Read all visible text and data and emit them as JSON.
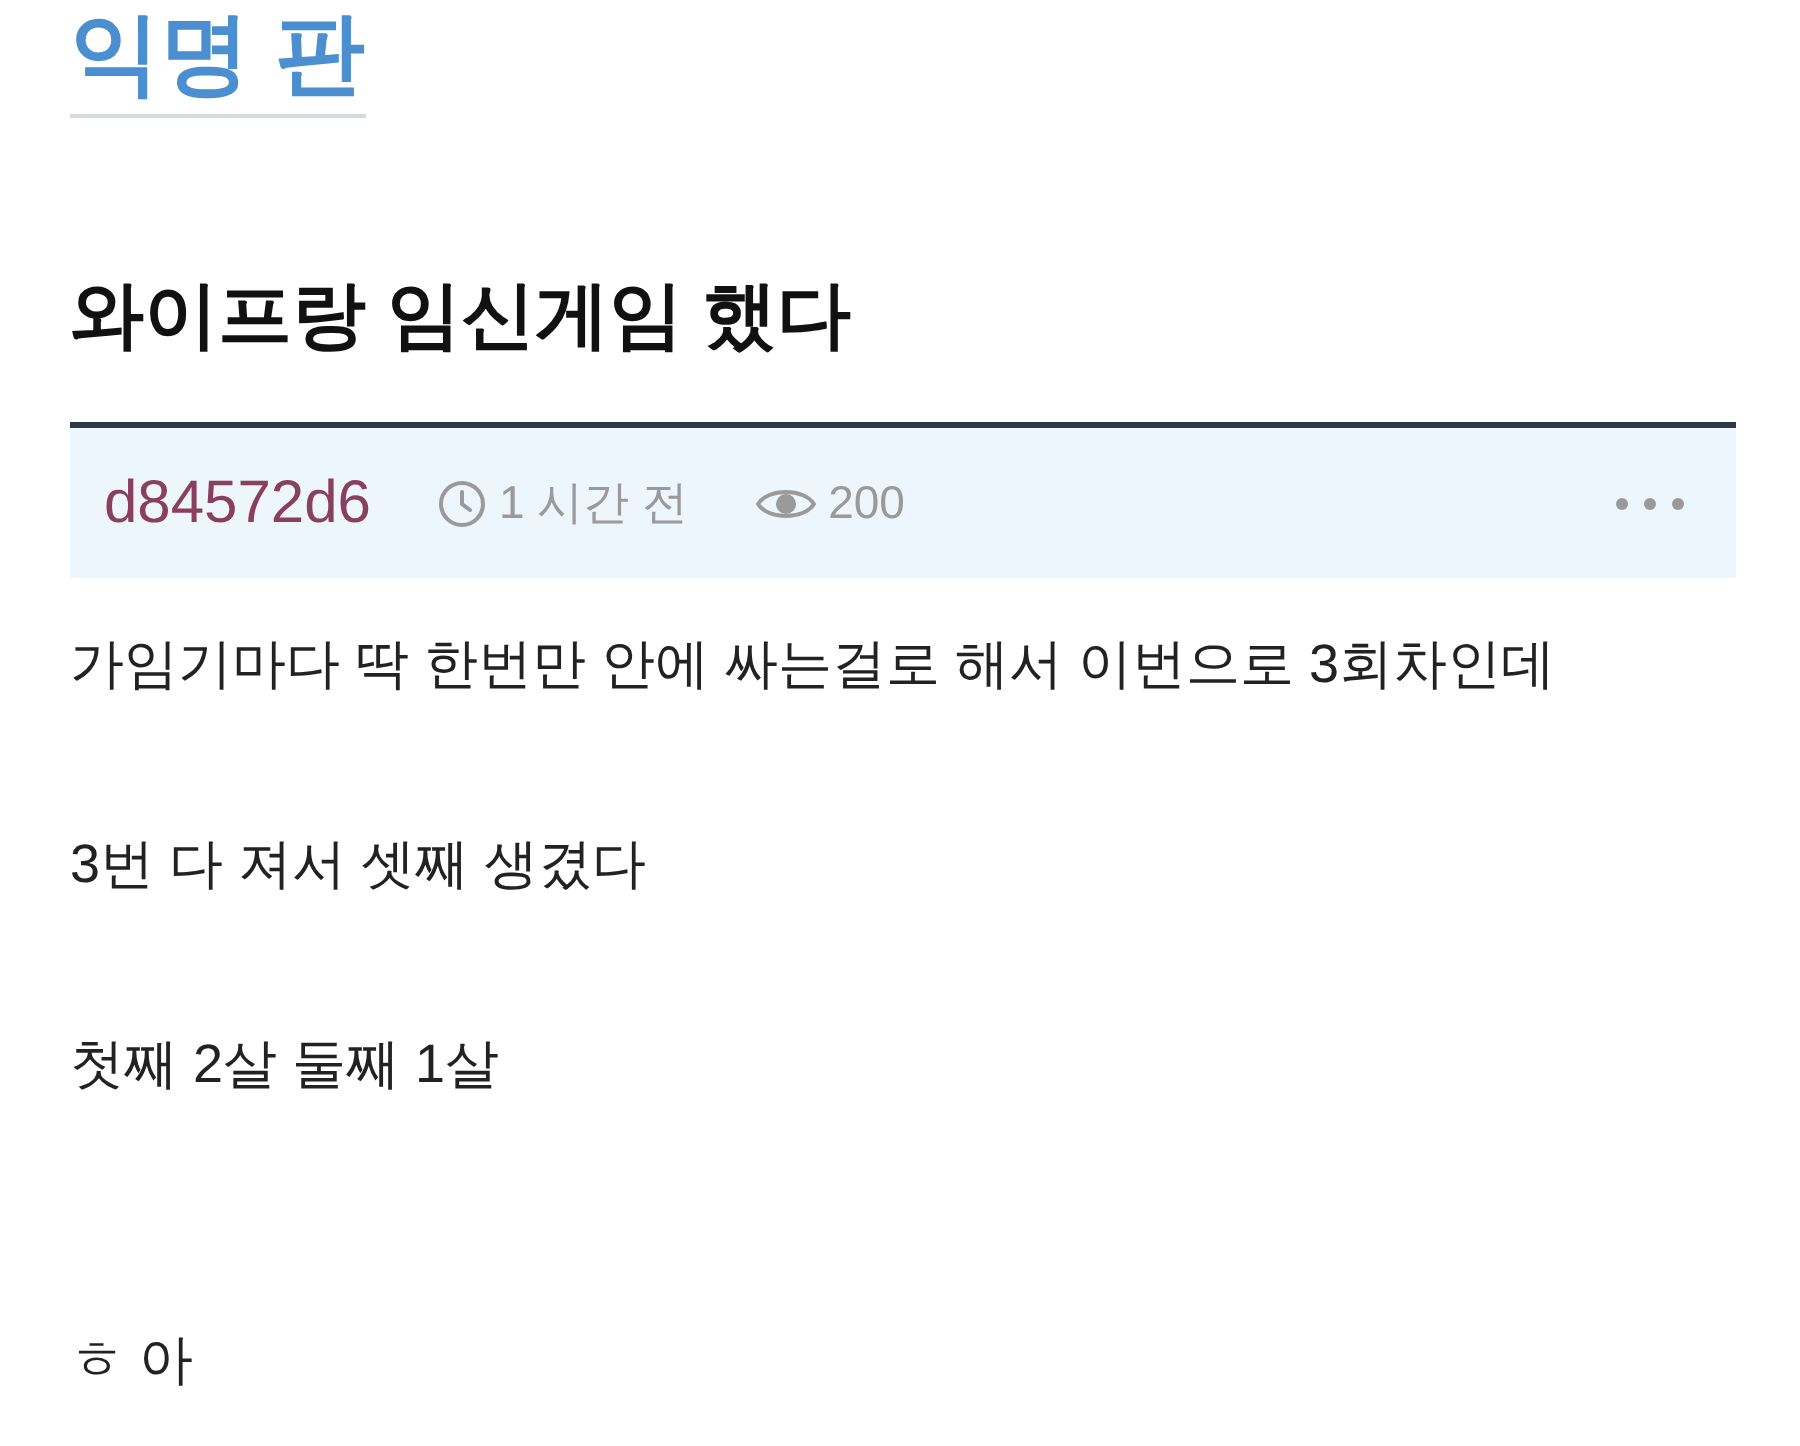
{
  "board": {
    "title": "익명 판"
  },
  "post": {
    "title": "와이프랑 임신게임 했다",
    "author": "d84572d6",
    "time": "1 시간 전",
    "views": "200"
  },
  "body": {
    "paragraphs": [
      "가임기마다 딱 한번만 안에 싸는걸로 해서 이번으로 3회차인데",
      "3번 다 져서 셋째 생겼다",
      "첫째 2살 둘째 1살",
      "ㅎ 아"
    ]
  }
}
